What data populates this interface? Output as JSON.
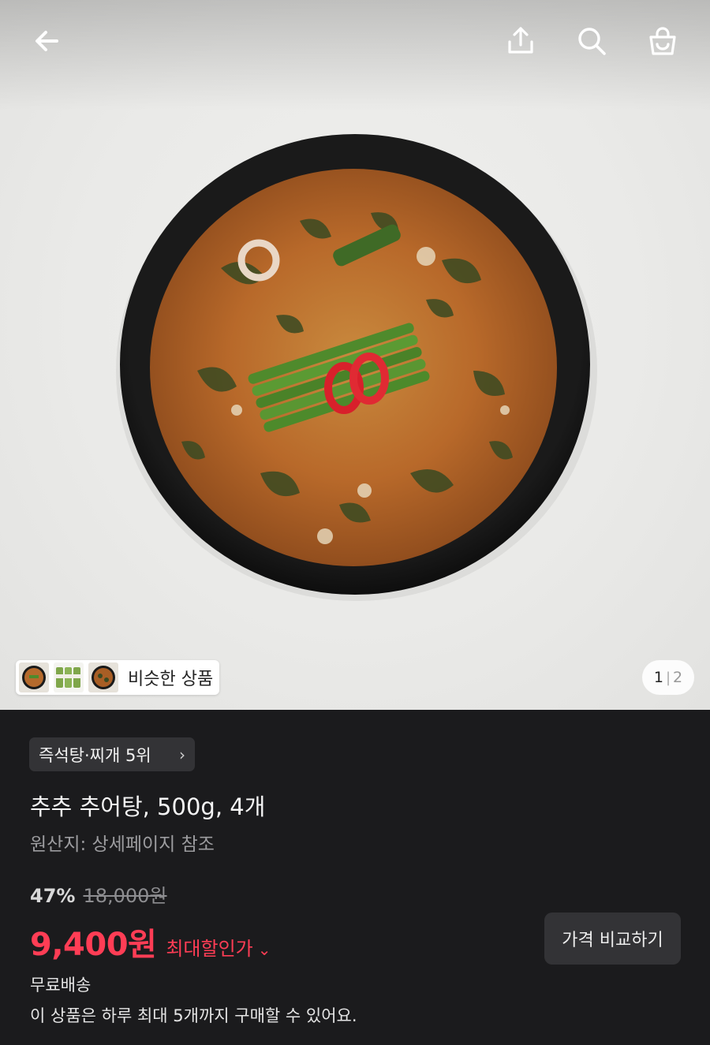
{
  "topbar": {
    "back_icon": "arrow-left-icon",
    "share_icon": "share-upload-icon",
    "search_icon": "search-icon",
    "cart_icon": "shopping-bag-icon"
  },
  "gallery": {
    "similar_label": "비슷한 상품",
    "current_index": "1",
    "total": "2"
  },
  "product": {
    "rank_badge": "즉석탕·찌개 5위",
    "title": "추추 추어탕, 500g, 4개",
    "origin": "원산지: 상세페이지 참조",
    "discount_rate": "47%",
    "original_price": "18,000원",
    "sale_price": "9,400원",
    "max_discount_label": "최대할인가",
    "compare_button": "가격 비교하기",
    "shipping": "무료배송",
    "purchase_limit": "이 상품은 하루 최대 5개까지 구매할 수 있어요."
  },
  "colors": {
    "accent_price": "#ff3d55",
    "info_background": "#1b1b1d",
    "chip_background": "#333336"
  }
}
